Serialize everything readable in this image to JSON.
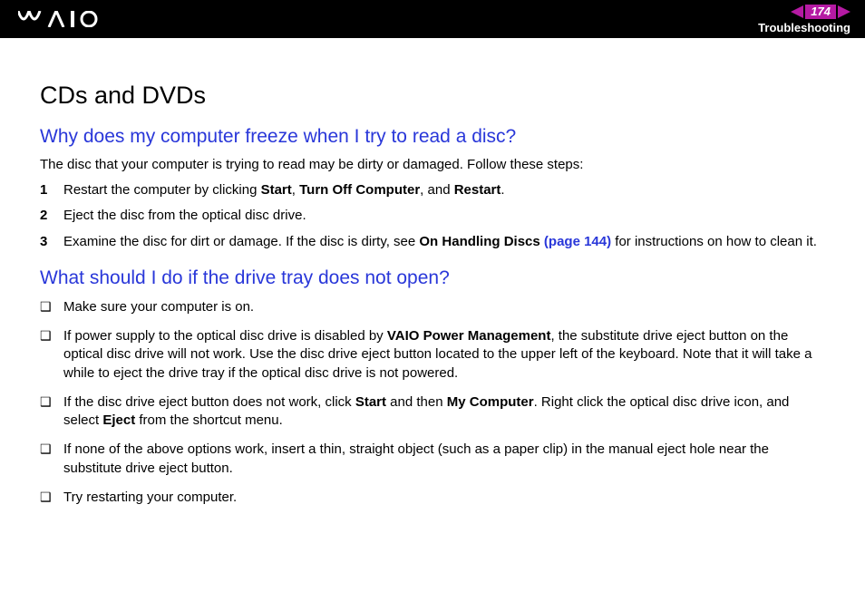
{
  "header": {
    "page_number": "174",
    "section": "Troubleshooting"
  },
  "title": "CDs and DVDs",
  "q1": {
    "heading": "Why does my computer freeze when I try to read a disc?",
    "intro": "The disc that your computer is trying to read may be dirty or damaged. Follow these steps:",
    "steps": [
      {
        "n": "1",
        "pre": "Restart the computer by clicking ",
        "b1": "Start",
        "m1": ", ",
        "b2": "Turn Off Computer",
        "m2": ", and ",
        "b3": "Restart",
        "post": "."
      },
      {
        "n": "2",
        "text": "Eject the disc from the optical disc drive."
      },
      {
        "n": "3",
        "pre": "Examine the disc for dirt or damage. If the disc is dirty, see ",
        "b1": "On Handling Discs",
        "link": " (page 144)",
        "post": " for instructions on how to clean it."
      }
    ]
  },
  "q2": {
    "heading": "What should I do if the drive tray does not open?",
    "items": [
      {
        "text": "Make sure your computer is on."
      },
      {
        "pre": "If power supply to the optical disc drive is disabled by ",
        "b1": "VAIO Power Management",
        "post": ", the substitute drive eject button on the optical disc drive will not work. Use the disc drive eject button located to the upper left of the keyboard. Note that it will take a while to eject the drive tray if the optical disc drive is not powered."
      },
      {
        "pre": "If the disc drive eject button does not work, click ",
        "b1": "Start",
        "m1": " and then ",
        "b2": "My Computer",
        "m2": ". Right click the optical disc drive icon, and select ",
        "b3": "Eject",
        "post": " from the shortcut menu."
      },
      {
        "text": "If none of the above options work, insert a thin, straight object (such as a paper clip) in the manual eject hole near the substitute drive eject button."
      },
      {
        "text": "Try restarting your computer."
      }
    ]
  }
}
